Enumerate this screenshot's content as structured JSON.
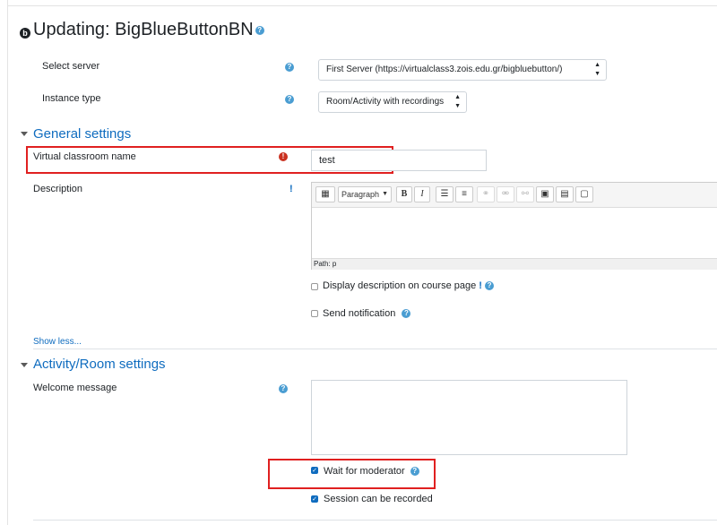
{
  "page": {
    "title": "Updating: BigBlueButtonBN",
    "module_icon_letter": "b"
  },
  "fields": {
    "select_server": {
      "label": "Select server",
      "value": "First Server (https://virtualclass3.zois.edu.gr/bigbluebutton/)"
    },
    "instance_type": {
      "label": "Instance type",
      "value": "Room/Activity with recordings"
    }
  },
  "general": {
    "section_title": "General settings",
    "name_label": "Virtual classroom name",
    "name_value": "test",
    "description_label": "Description",
    "description_marker": "!",
    "editor": {
      "paragraph_label": "Paragraph",
      "bold": "B",
      "italic": "I",
      "path": "Path: p"
    },
    "display_description_label": "Display description on course page",
    "display_description_marker": "!",
    "send_notification_label": "Send notification",
    "show_less": "Show less..."
  },
  "activity": {
    "section_title": "Activity/Room settings",
    "welcome_label": "Welcome message",
    "welcome_value": "",
    "wait_for_moderator_label": "Wait for moderator",
    "wait_for_moderator_checked": true,
    "session_recorded_label": "Session can be recorded",
    "session_recorded_checked": true
  },
  "icons": {
    "help": "?",
    "required": "!",
    "check": "✓"
  },
  "colors": {
    "link": "#0f6cbf",
    "highlight_box": "#e02020",
    "help_icon": "#4a9dd2",
    "required_icon": "#ca3120"
  }
}
